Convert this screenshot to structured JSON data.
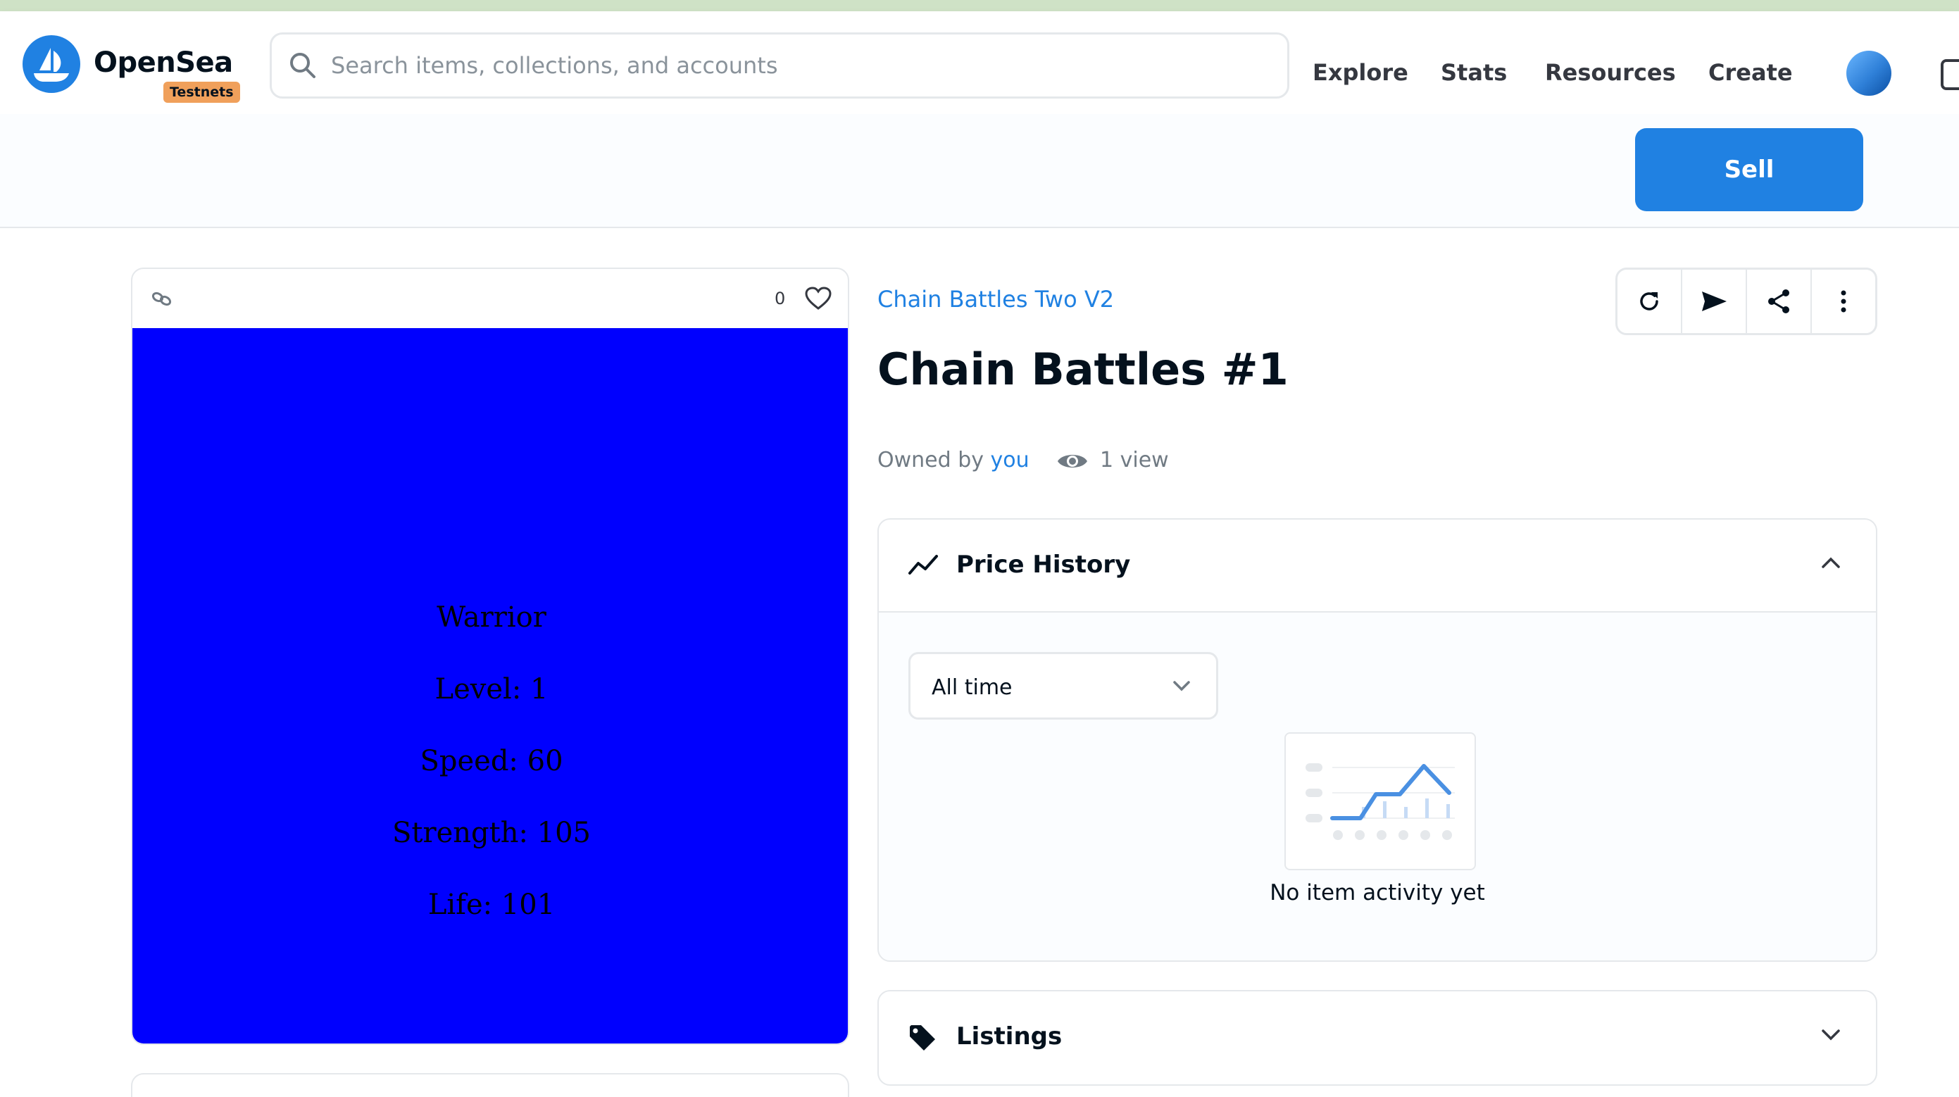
{
  "header": {
    "brand": "OpenSea",
    "badge": "Testnets",
    "search_placeholder": "Search items, collections, and accounts",
    "nav": [
      "Explore",
      "Stats",
      "Resources",
      "Create"
    ]
  },
  "actions": {
    "sell_label": "Sell"
  },
  "media": {
    "favorites_count": "0",
    "image_lines": [
      "Warrior",
      "Level: 1",
      "Speed: 60",
      "Strength: 105",
      "Life: 101"
    ],
    "image_background": "#0000fe"
  },
  "item": {
    "collection": "Chain Battles Two V2",
    "title": "Chain Battles #1",
    "owned_by_label": "Owned by",
    "owner": "you",
    "views": "1 view"
  },
  "price_history": {
    "title": "Price History",
    "range": "All time",
    "empty_message": "No item activity yet"
  },
  "listings": {
    "title": "Listings"
  },
  "icons": [
    "opensea-logo-icon",
    "search-icon",
    "chain-link-icon",
    "heart-icon",
    "refresh-icon",
    "send-icon",
    "share-icon",
    "more-icon",
    "eye-icon",
    "trend-icon",
    "chevron-up-icon",
    "chevron-down-icon",
    "tag-icon",
    "wallet-icon"
  ],
  "colors": {
    "accent": "#2081e2",
    "testnet_badge": "#f0a05b",
    "nft_background": "#0000fe"
  }
}
